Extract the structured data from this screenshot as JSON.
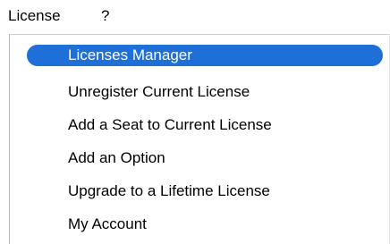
{
  "menubar": {
    "items": [
      {
        "label": "License"
      },
      {
        "label": "?"
      }
    ]
  },
  "dropdown": {
    "items": [
      {
        "label": "Licenses Manager",
        "highlighted": true
      },
      {
        "label": "Unregister Current License",
        "highlighted": false
      },
      {
        "label": "Add a Seat to Current License",
        "highlighted": false
      },
      {
        "label": "Add an Option",
        "highlighted": false
      },
      {
        "label": "Upgrade to a Lifetime License",
        "highlighted": false
      },
      {
        "label": "My Account",
        "highlighted": false
      }
    ]
  },
  "colors": {
    "highlight": "#1f6fd8",
    "highlight_text": "#ffffff",
    "text": "#000000",
    "background": "#ffffff"
  }
}
